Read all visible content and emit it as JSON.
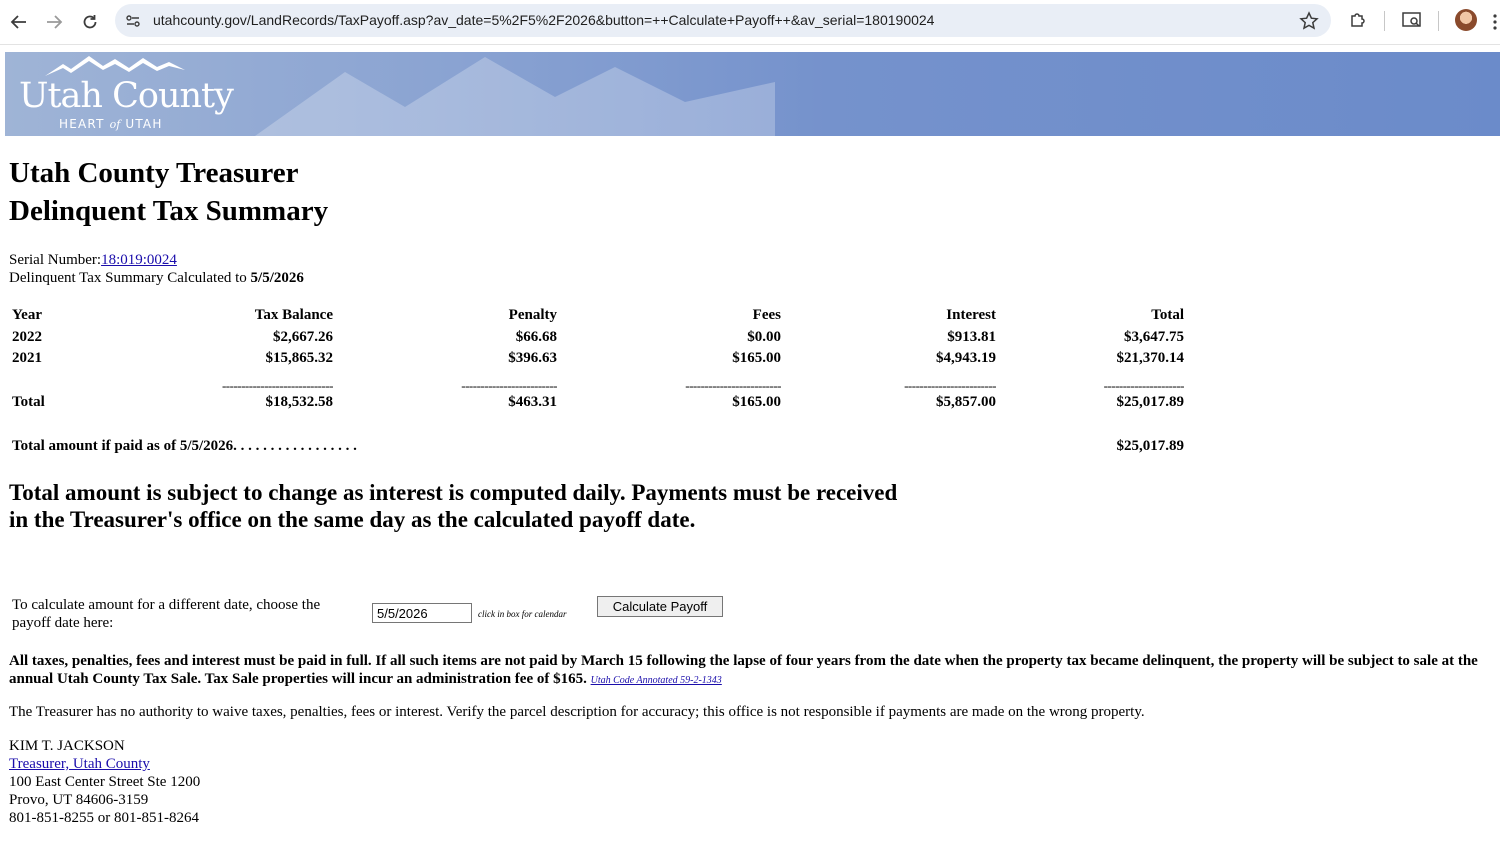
{
  "browser": {
    "url": "utahcounty.gov/LandRecords/TaxPayoff.asp?av_date=5%2F5%2F2026&button=++Calculate+Payoff++&av_serial=180190024"
  },
  "banner": {
    "logo_title": "Utah County",
    "logo_tag_1": "HEART",
    "logo_tag_of": "of",
    "logo_tag_2": "UTAH"
  },
  "page": {
    "title_line1": "Utah County Treasurer",
    "title_line2": "Delinquent Tax Summary",
    "serial_label": "Serial Number:",
    "serial_value": "18:019:0024",
    "calc_label": "Delinquent Tax Summary Calculated to ",
    "calc_date": "5/5/2026"
  },
  "table": {
    "headers": [
      "Year",
      "Tax Balance",
      "Penalty",
      "Fees",
      "Interest",
      "Total"
    ],
    "rows": [
      [
        "2022",
        "$2,667.26",
        "$66.68",
        "$0.00",
        "$913.81",
        "$3,647.75"
      ],
      [
        "2021",
        "$15,865.32",
        "$396.63",
        "$165.00",
        "$4,943.19",
        "$21,370.14"
      ]
    ],
    "dashes": [
      "-----------------------------",
      "-------------------------",
      "-------------------------",
      "------------------------",
      "---------------------"
    ],
    "total_row": [
      "Total",
      "$18,532.58",
      "$463.31",
      "$165.00",
      "$5,857.00",
      "$25,017.89"
    ],
    "paid_label": "Total amount if paid as of 5/5/2026. . . . . . . . . . . . . . . . .",
    "paid_value": "$25,017.89"
  },
  "notice": "Total amount is subject to change as interest is computed daily.    Payments must be received in the Treasurer's office on the same day as the calculated payoff date.",
  "calculator": {
    "label": "To calculate amount for a different date, choose the payoff date here:",
    "date_value": "5/5/2026",
    "hint": "click in box for calendar",
    "button": "Calculate Payoff"
  },
  "warning": {
    "text": "All taxes, penalties, fees and interest must be paid in full.  If all such items are not paid by March 15 following the lapse of four years from the date when the property tax became delinquent, the property will be subject to sale at the annual Utah County Tax Sale. Tax Sale properties will incur an administration fee of $165. ",
    "link": "Utah Code Annotated 59-2-1343"
  },
  "authority": "The Treasurer has no authority to waive taxes, penalties, fees or interest. Verify the parcel description for accuracy; this office is not responsible if payments are made on the wrong property.",
  "contact": {
    "name": "KIM T. JACKSON",
    "title_link": "Treasurer, Utah County",
    "address1": "100 East Center Street Ste 1200",
    "address2": "Provo, UT 84606-3159",
    "phone": "801-851-8255 or 801-851-8264"
  }
}
